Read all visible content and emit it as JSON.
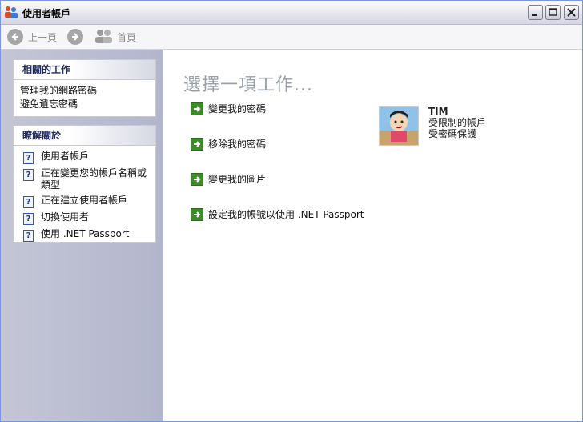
{
  "window": {
    "title": "使用者帳戶"
  },
  "toolbar": {
    "back_label": "上一頁",
    "home_label": "首頁"
  },
  "sidebar": {
    "related_tasks": {
      "title": "相關的工作",
      "items": [
        {
          "label": "管理我的網路密碼"
        },
        {
          "label": "避免遺忘密碼"
        }
      ]
    },
    "learn_about": {
      "title": "瞭解關於",
      "items": [
        {
          "label": "使用者帳戶"
        },
        {
          "label": "正在變更您的帳戶名稱或類型"
        },
        {
          "label": "正在建立使用者帳戶"
        },
        {
          "label": "切換使用者"
        },
        {
          "label": "使用 .NET Passport"
        }
      ]
    }
  },
  "main": {
    "heading": "選擇一項工作...",
    "tasks": [
      {
        "label": "變更我的密碼"
      },
      {
        "label": "移除我的密碼"
      },
      {
        "label": "變更我的圖片"
      },
      {
        "label": "設定我的帳號以使用 .NET Passport"
      }
    ],
    "user": {
      "name": "TIM",
      "account_type": "受限制的帳戶",
      "status": "受密碼保護"
    }
  },
  "colors": {
    "accent_green": "#3c8c28",
    "sidebar_bg": "#b8bccf",
    "heading_gray": "#9aa0a8"
  },
  "icons": {
    "title": "users-icon",
    "back": "back-arrow-icon",
    "forward": "forward-arrow-icon",
    "home": "home-users-icon",
    "task": "green-arrow-icon",
    "help": "help-icon"
  }
}
